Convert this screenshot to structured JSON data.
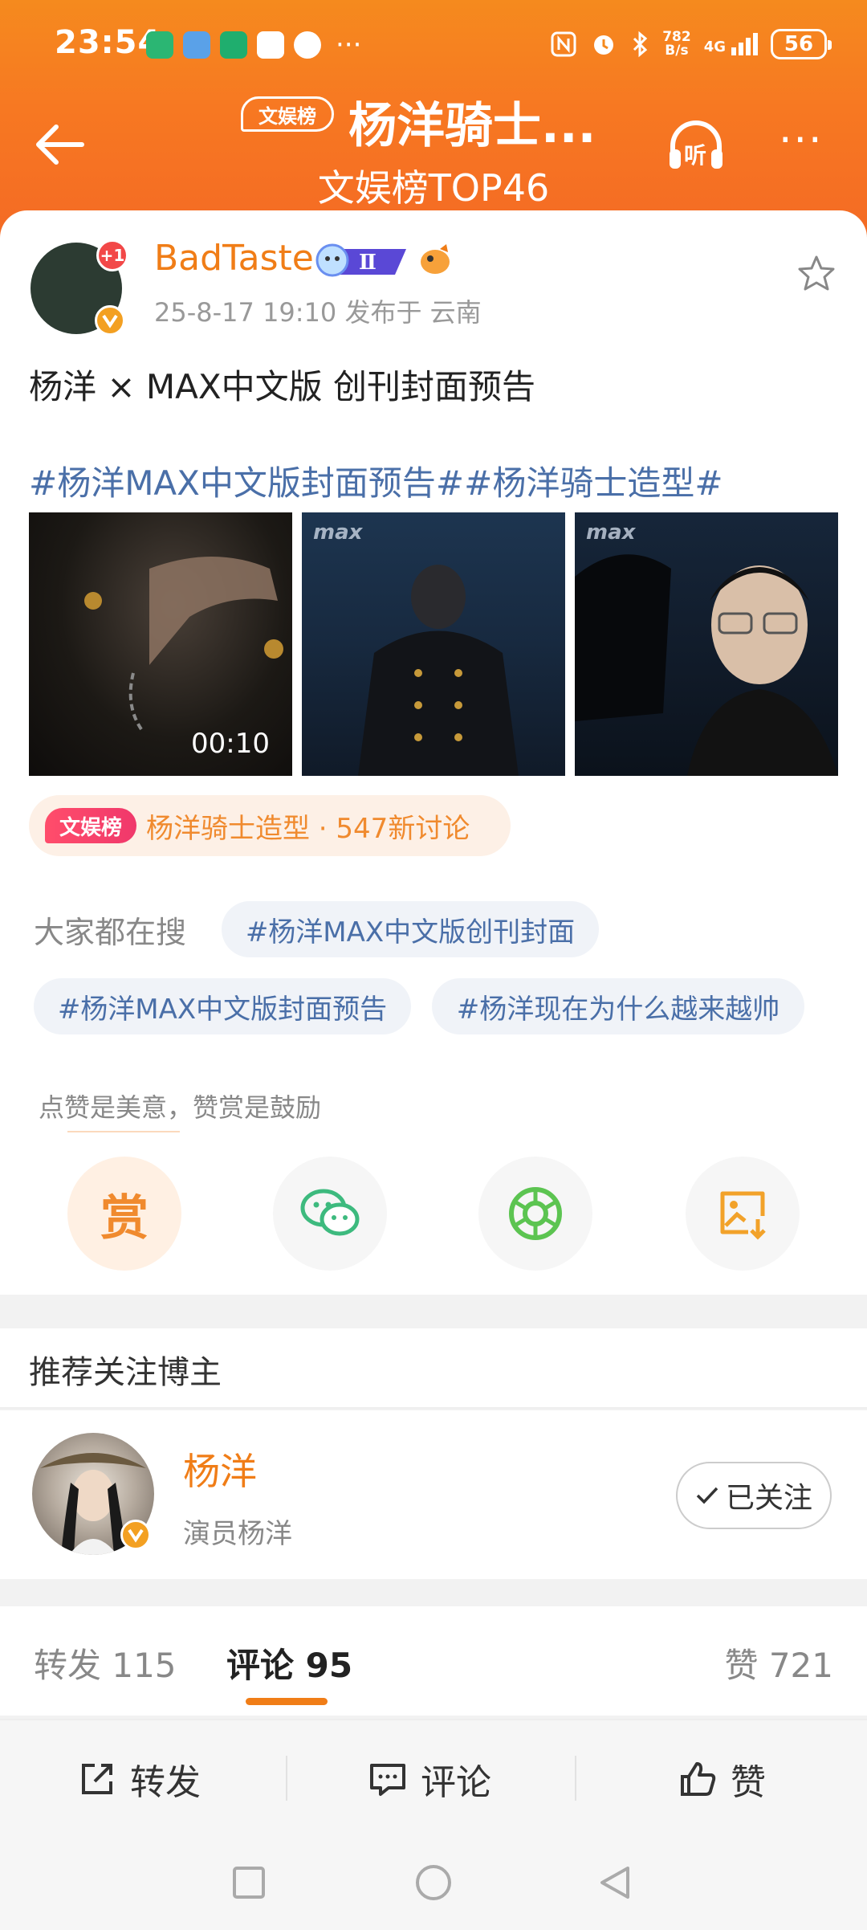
{
  "status_bar": {
    "time": "23:54",
    "net_speed_top": "782",
    "net_speed_bottom": "B/s",
    "network": "4G",
    "battery": "56"
  },
  "header": {
    "badge": "文娱榜",
    "title": "杨洋骑士...",
    "subtitle": "文娱榜TOP46",
    "listen_label": "听"
  },
  "post": {
    "author": "BadTaste",
    "notification_badge": "+1",
    "level_badge": "Ⅱ",
    "meta": "25-8-17 19:10   发布于 云南",
    "text": "杨洋 × MAX中文版 创刊封面预告",
    "hashtags": "#杨洋MAX中文版封面预告##杨洋骑士造型#",
    "video_duration": "00:10",
    "image_brand": "max"
  },
  "topic": {
    "badge": "文娱榜",
    "text": "杨洋骑士造型 · 547新讨论"
  },
  "search": {
    "label": "大家都在搜",
    "chips": [
      "#杨洋MAX中文版创刊封面",
      "#杨洋MAX中文版封面预告",
      "#杨洋现在为什么越来越帅"
    ]
  },
  "reward": {
    "hint": "点赞是美意，赞赏是鼓励",
    "reward_label": "赏"
  },
  "recommend": {
    "title": "推荐关注博主",
    "name": "杨洋",
    "desc": "演员杨洋",
    "follow_label": "已关注"
  },
  "tabs": {
    "repost": "转发 115",
    "comment": "评论 95",
    "like": "赞 721"
  },
  "actions": {
    "repost": "转发",
    "comment": "评论",
    "like": "赞"
  },
  "colors": {
    "brand_orange": "#f07d17",
    "header_start": "#f58a1e",
    "link_blue": "#4a6fa8"
  }
}
